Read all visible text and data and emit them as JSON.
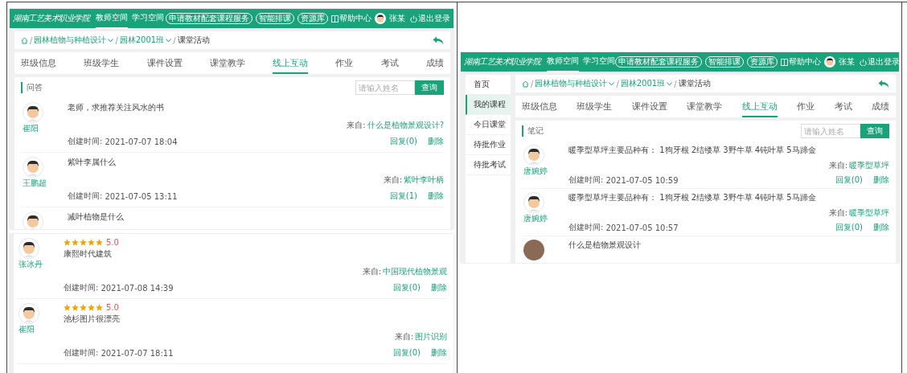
{
  "document": {
    "cells": [
      {
        "screenshots": [
          {
            "kind": "full",
            "header": {
              "logo": "湖南工艺美术职业学院",
              "nav": [
                {
                  "label": "教师空间",
                  "selected": true
                },
                {
                  "label": "学习空间",
                  "selected": false
                }
              ],
              "pills": [
                "申请教材配套课程服务",
                "智能排课",
                "资源库"
              ],
              "help": "帮助中心",
              "user": "张某",
              "logout": "退出登录"
            },
            "breadcrumb": {
              "separator": "/",
              "items": [
                "园林植物与种植设计",
                "园林2001班",
                "课堂活动"
              ]
            },
            "tabs": [
              {
                "label": "班级信息",
                "selected": false
              },
              {
                "label": "班级学生",
                "selected": false
              },
              {
                "label": "课件设置",
                "selected": false
              },
              {
                "label": "课堂教学",
                "selected": false
              },
              {
                "label": "线上互动",
                "selected": true
              },
              {
                "label": "作业",
                "selected": false
              },
              {
                "label": "考试",
                "selected": false
              },
              {
                "label": "成绩",
                "selected": false
              }
            ],
            "section": {
              "title": "问答",
              "placeholder": "请输入姓名",
              "button": "查询"
            },
            "posts": [
              {
                "kind": "cartoon",
                "author": "崔阳",
                "text": "老师，求推荐关注风水的书",
                "source_label": "来自:",
                "source": "什么是植物景观设计?",
                "created_label": "创建时间:",
                "created": "2021-07-07 18:04",
                "reply": "回复(0)",
                "delete": "删除"
              },
              {
                "kind": "cartoon",
                "author": "王鹏超",
                "text": "紫叶李属什么",
                "source_label": "来自:",
                "source": "紫叶李叶柄",
                "created_label": "创建时间:",
                "created": "2021-07-05 13:11",
                "reply": "回复(1)",
                "delete": "删除"
              },
              {
                "kind": "cartoon",
                "text": "减叶植物是什么"
              }
            ]
          },
          {
            "kind": "posts",
            "posts": [
              {
                "kind": "cartoon",
                "author": "张冰丹",
                "stars": 5,
                "rating": "5.0",
                "text": "康熙时代建筑",
                "source_label": "来自:",
                "source": "中国现代植物景观",
                "created_label": "创建时间:",
                "created": "2021-07-08 14:39",
                "reply": "回复(0)",
                "delete": "删除"
              },
              {
                "kind": "cartoon",
                "author": "崔阳",
                "stars": 5,
                "rating": "5.0",
                "text": "池杉图片很漂亮",
                "source_label": "来自:",
                "source": "图片识别",
                "created_label": "创建时间:",
                "created": "2021-07-07 18:11",
                "reply": "回复(0)",
                "delete": "删除"
              }
            ]
          }
        ]
      },
      {
        "screenshots": [
          {
            "kind": "full",
            "header": {
              "logo": "湖南工艺美术职业学院",
              "nav": [
                {
                  "label": "教师空间",
                  "selected": true
                },
                {
                  "label": "学习空间",
                  "selected": false
                }
              ],
              "pills": [
                "申请教材配套课程服务",
                "智能排课",
                "资源库"
              ],
              "help": "帮助中心",
              "user": "张某",
              "logout": "退出登录"
            },
            "sidebar": [
              {
                "label": "首页",
                "selected": false
              },
              {
                "label": "我的课程",
                "selected": true
              },
              {
                "label": "今日课堂",
                "selected": false
              },
              {
                "label": "待批作业",
                "selected": false
              },
              {
                "label": "待批考试",
                "selected": false
              }
            ],
            "breadcrumb": {
              "separator": "/",
              "items": [
                "园林植物与种植设计",
                "园林2001班",
                "课堂活动"
              ]
            },
            "tabs": [
              {
                "label": "班级信息",
                "selected": false
              },
              {
                "label": "班级学生",
                "selected": false
              },
              {
                "label": "课件设置",
                "selected": false
              },
              {
                "label": "课堂教学",
                "selected": false
              },
              {
                "label": "线上互动",
                "selected": true
              },
              {
                "label": "作业",
                "selected": false
              },
              {
                "label": "考试",
                "selected": false
              },
              {
                "label": "成绩",
                "selected": false
              }
            ],
            "section": {
              "title": "笔记",
              "placeholder": "请输入姓名",
              "button": "查询"
            },
            "posts": [
              {
                "kind": "cartoon",
                "author": "唐婉婷",
                "text": "暖季型草坪主要品种有： 1狗牙根 2结缕草 3野牛草 4钝叶草 5马蹄金",
                "source_label": "来自:",
                "source": "暖季型草坪",
                "created_label": "创建时间:",
                "created": "2021-07-05 10:59",
                "reply": "回复(0)",
                "delete": "删除"
              },
              {
                "kind": "cartoon",
                "author": "唐婉婷",
                "text": "暖季型草坪主要品种有： 1狗牙根 2结缕草 3野牛草 4钝叶草 5马蹄金",
                "source_label": "来自:",
                "source": "暖季型草坪",
                "created_label": "创建时间:",
                "created": "2021-07-05 10:57",
                "reply": "回复(0)",
                "delete": "删除"
              },
              {
                "kind": "photo",
                "text": "什么是植物景观设计"
              }
            ]
          }
        ]
      }
    ]
  }
}
